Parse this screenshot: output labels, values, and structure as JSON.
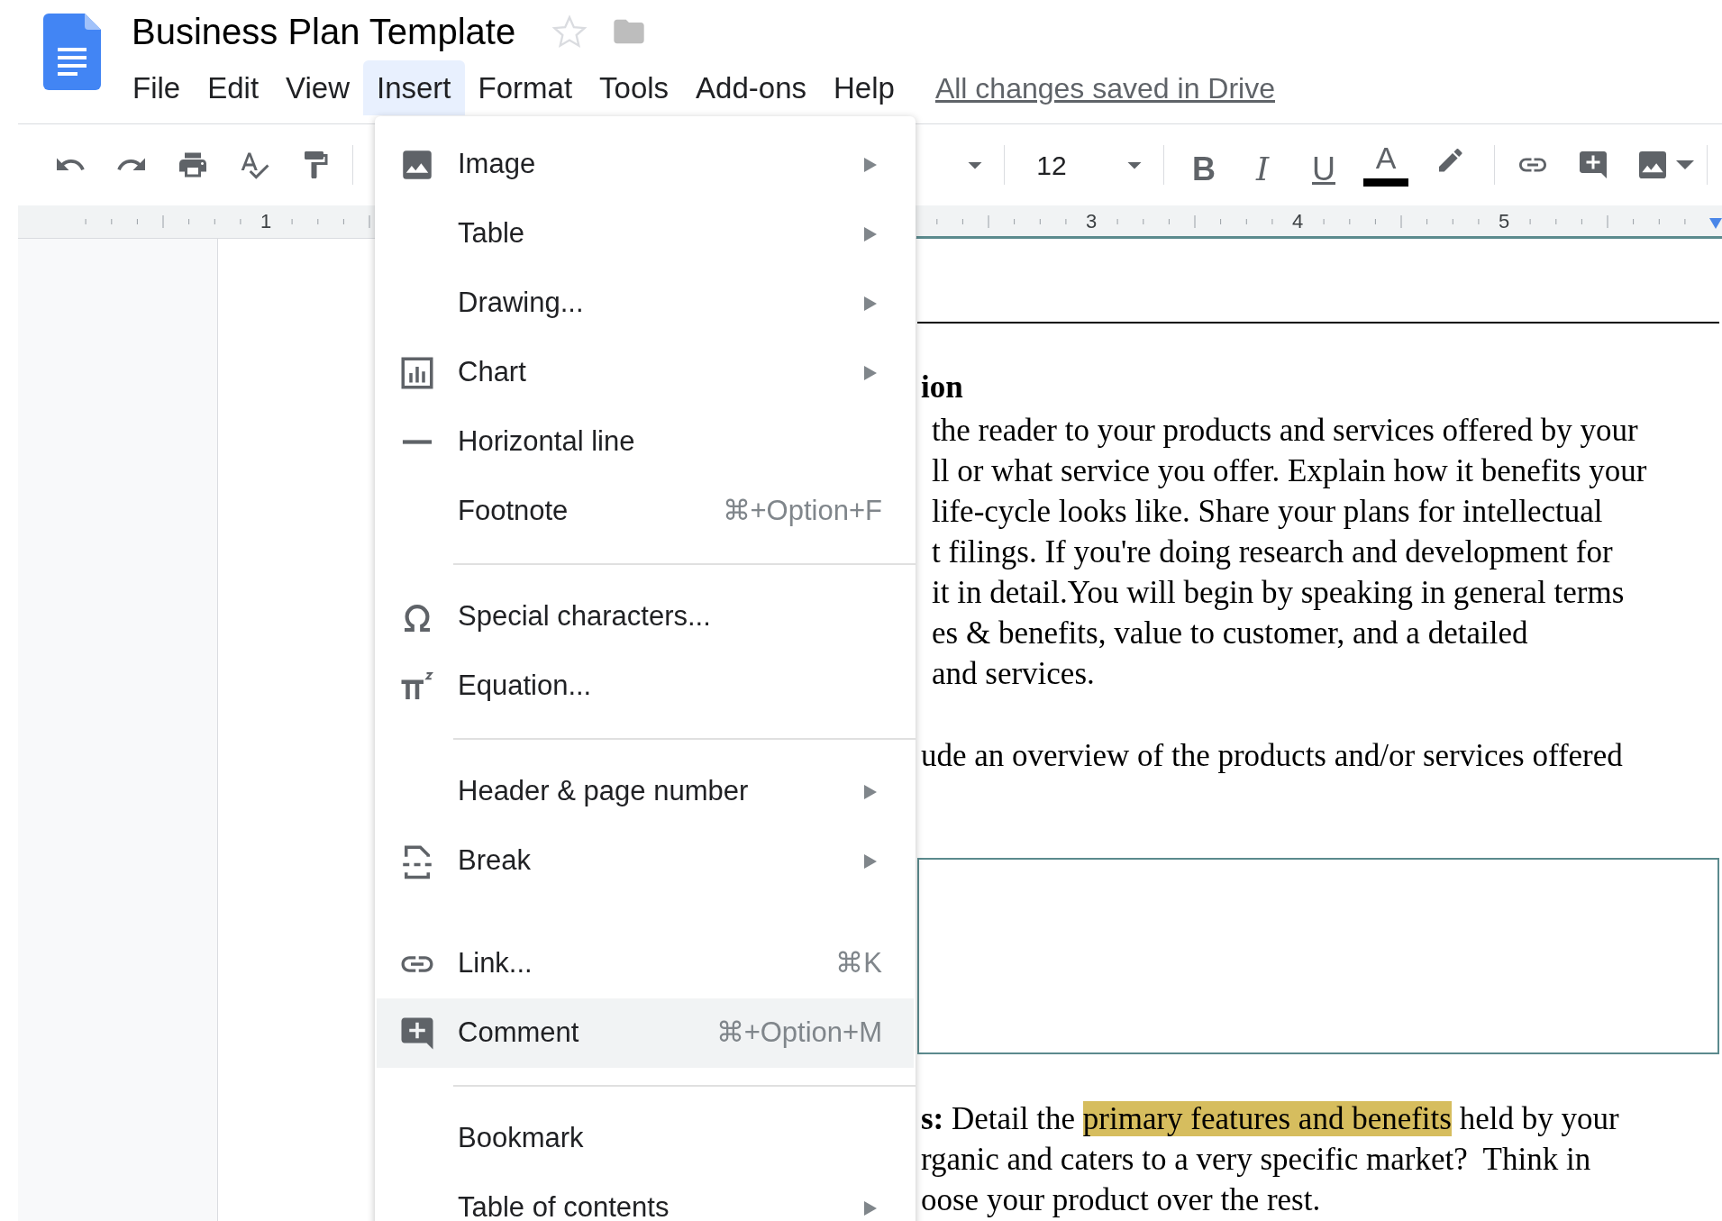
{
  "app": {
    "title": "Business Plan Template",
    "starred": false
  },
  "menu_bar": [
    {
      "label": "File",
      "selected": false
    },
    {
      "label": "Edit",
      "selected": false
    },
    {
      "label": "View",
      "selected": false
    },
    {
      "label": "Insert",
      "selected": true
    },
    {
      "label": "Format",
      "selected": false
    },
    {
      "label": "Tools",
      "selected": false
    },
    {
      "label": "Add-ons",
      "selected": false
    },
    {
      "label": "Help",
      "selected": false
    }
  ],
  "save_status": "All changes saved in Drive",
  "toolbar": {
    "font_size": "12",
    "bold": "B",
    "italic": "I",
    "underline": "U",
    "text_color": "A"
  },
  "ruler": {
    "labels": [
      "1",
      "3",
      "4",
      "5"
    ]
  },
  "insert_menu": [
    {
      "kind": "item",
      "label": "Image",
      "submenu": true,
      "selected": false
    },
    {
      "kind": "item",
      "label": "Table",
      "submenu": true,
      "selected": false
    },
    {
      "kind": "item",
      "label": "Drawing...",
      "submenu": true,
      "selected": false
    },
    {
      "kind": "item",
      "label": "Chart",
      "submenu": true,
      "selected": false
    },
    {
      "kind": "item",
      "label": "Horizontal line",
      "submenu": false,
      "selected": false
    },
    {
      "kind": "item",
      "label": "Footnote",
      "submenu": false,
      "shortcut": "⌘+Option+F",
      "selected": false
    },
    {
      "kind": "separator"
    },
    {
      "kind": "item",
      "label": "Special characters...",
      "submenu": false,
      "selected": false
    },
    {
      "kind": "item",
      "label": "Equation...",
      "submenu": false,
      "selected": false
    },
    {
      "kind": "separator"
    },
    {
      "kind": "item",
      "label": "Header & page number",
      "submenu": true,
      "selected": false
    },
    {
      "kind": "item",
      "label": "Break",
      "submenu": true,
      "selected": false
    },
    {
      "kind": "item",
      "label": "Link...",
      "submenu": false,
      "shortcut": "⌘K",
      "selected": false
    },
    {
      "kind": "item",
      "label": "Comment",
      "submenu": false,
      "shortcut": "⌘+Option+M",
      "selected": true
    },
    {
      "kind": "separator"
    },
    {
      "kind": "item",
      "label": "Bookmark",
      "submenu": false,
      "selected": false
    },
    {
      "kind": "item",
      "label": "Table of contents",
      "submenu": true,
      "selected": false
    }
  ],
  "document": {
    "heading": "ion",
    "body_lines": [
      "the reader to your products and services offered by your",
      "ll or what service you offer. Explain how it benefits your",
      "life-cycle looks like. Share your plans for intellectual",
      "t filings. If you're doing research and development for",
      "it in detail.You will begin by speaking in general terms",
      "es & benefits, value to customer, and a detailed",
      "and services."
    ],
    "overview_line": "ude an overview of the products and/or services offered",
    "lower_lines": [
      {
        "segments": [
          {
            "kind": "bold",
            "text": "s:"
          },
          {
            "kind": "plain",
            "text": " Detail the "
          },
          {
            "kind": "highlight",
            "text": "primary features and benefits"
          },
          {
            "kind": "plain",
            "text": " held by your"
          }
        ]
      },
      {
        "segments": [
          {
            "kind": "plain",
            "text": "rganic and caters to a very specific market?  Think in"
          }
        ]
      },
      {
        "segments": [
          {
            "kind": "plain",
            "text": "oose your product over the rest."
          }
        ]
      }
    ]
  }
}
